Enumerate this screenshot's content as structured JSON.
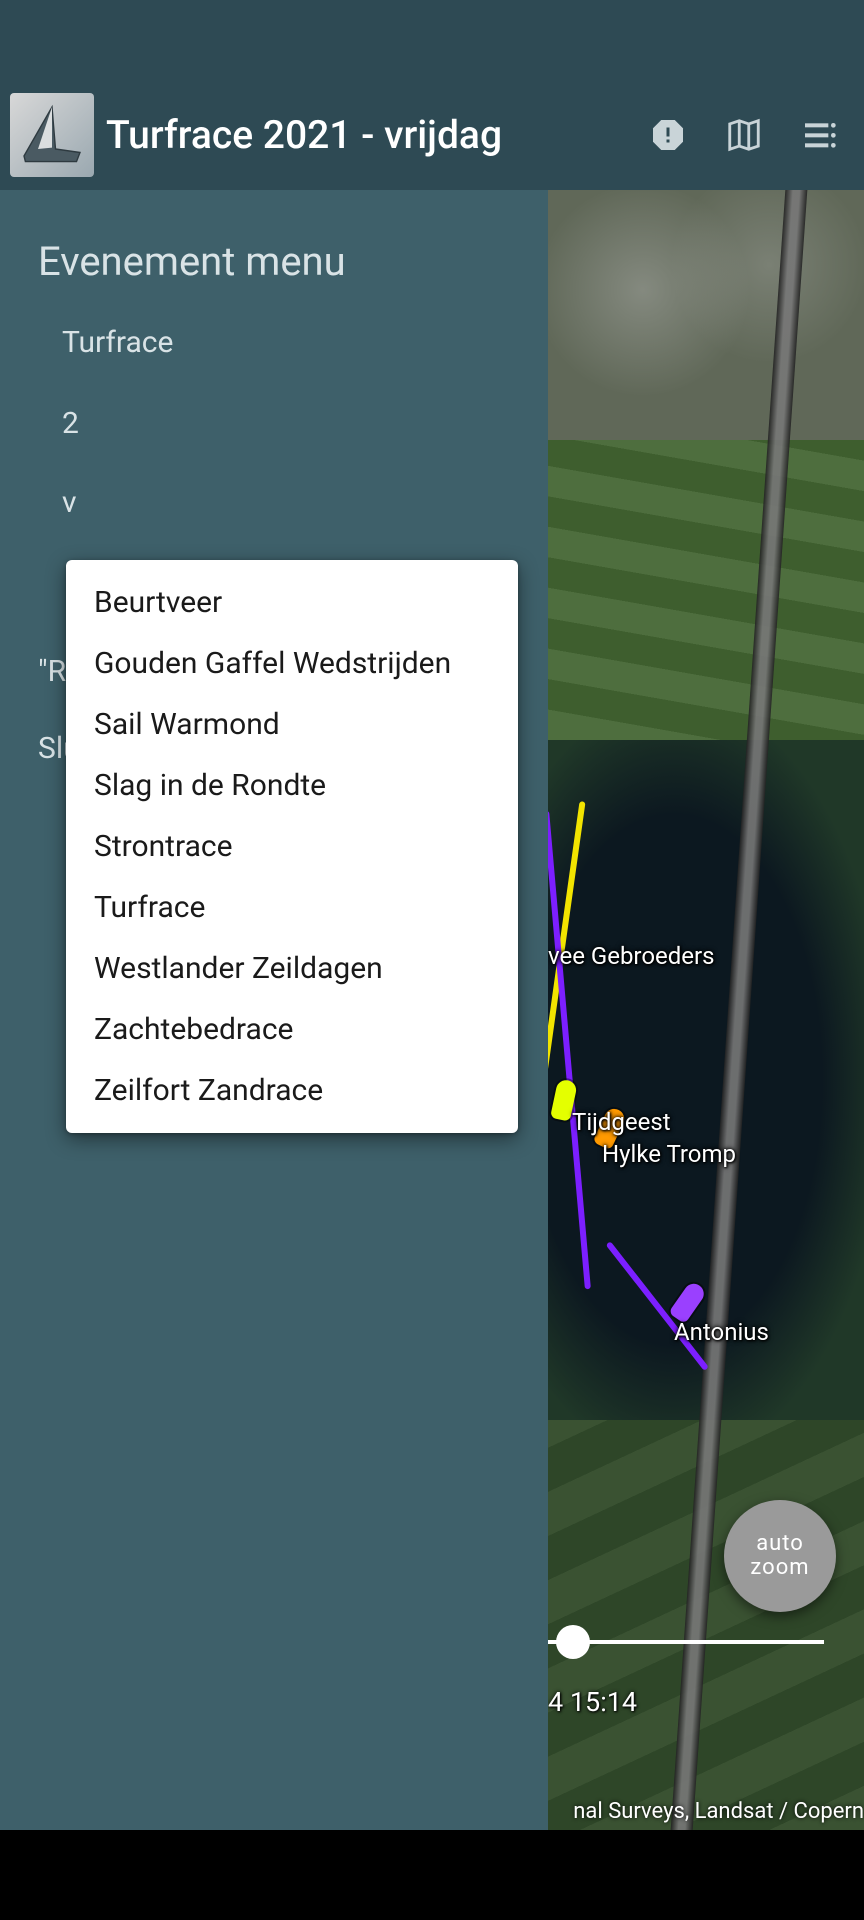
{
  "header": {
    "title": "Turfrace 2021 - vrijdag"
  },
  "sidebar": {
    "menu_title": "Evenement menu",
    "current_event": "Turfrace",
    "line_year": "2",
    "line_day": "v",
    "line_re": "\"Re",
    "line_slu": "Slu"
  },
  "dropdown": {
    "items": [
      "Beurtveer",
      "Gouden Gaffel Wedstrijden",
      "Sail Warmond",
      "Slag in de Rondte",
      "Strontrace",
      "Turfrace",
      "Westlander Zeildagen",
      "Zachtebedrace",
      "Zeilfort Zandrace"
    ]
  },
  "map": {
    "labels": {
      "vee_gebroeders": "vee Gebroeders",
      "tijdgeest": "Tijdgeest",
      "hylke_tromp": "Hylke Tromp",
      "antonius": "Antonius"
    },
    "auto_zoom_l1": "auto",
    "auto_zoom_l2": "zoom",
    "time": "4 15:14",
    "attribution": "nal Surveys, Landsat / Copern"
  }
}
